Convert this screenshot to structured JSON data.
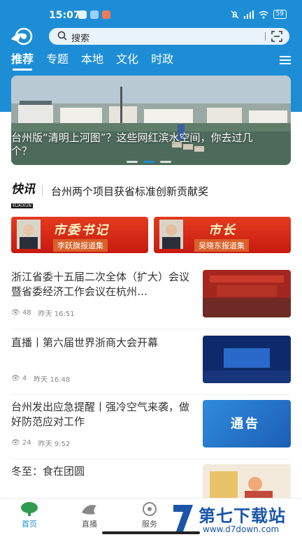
{
  "status_bar": {
    "time": "15:07",
    "battery": "59"
  },
  "search": {
    "placeholder": "搜索"
  },
  "tabs": [
    {
      "label": "推荐",
      "active": true
    },
    {
      "label": "专题",
      "active": false
    },
    {
      "label": "本地",
      "active": false
    },
    {
      "label": "文化",
      "active": false
    },
    {
      "label": "时政",
      "active": false
    }
  ],
  "banner": {
    "caption": "台州版“清明上河图”？这些网红滨水空间，你去过几个？",
    "active_dot": 1,
    "dot_count": 3
  },
  "flash": {
    "logo": "快讯",
    "logo_sub": "KUAIXUN",
    "text": "台州两个项目获省标准创新贡献奖"
  },
  "cards": [
    {
      "title": "市委书记",
      "subtitle": "李跃旗报道集"
    },
    {
      "title": "市长",
      "subtitle": "吴晓东报道集"
    }
  ],
  "news": [
    {
      "title": "浙江省委十五届二次全体（扩大）会议暨省委经济工作会议在杭州…",
      "views": "48",
      "time": "昨天 16:51"
    },
    {
      "title": "直播丨第六届世界浙商大会开幕",
      "views": "4",
      "time": "昨天 16:48"
    },
    {
      "title": "台州发出应急提醒丨强冷空气来袭，做好防范应对工作",
      "views": "24",
      "time": "昨天 9:52",
      "thumb_text": "通告"
    },
    {
      "title": "冬至：食在团圆",
      "views": "",
      "time": ""
    }
  ],
  "bottom_nav": [
    {
      "label": "首页",
      "active": true
    },
    {
      "label": "直播",
      "active": false
    },
    {
      "label": "服务",
      "active": false
    }
  ],
  "watermark": {
    "big": "第七下载站",
    "small": "www.d7down.com"
  },
  "colors": {
    "brand": "#1d8ed6",
    "card_red": "#c71a10"
  }
}
